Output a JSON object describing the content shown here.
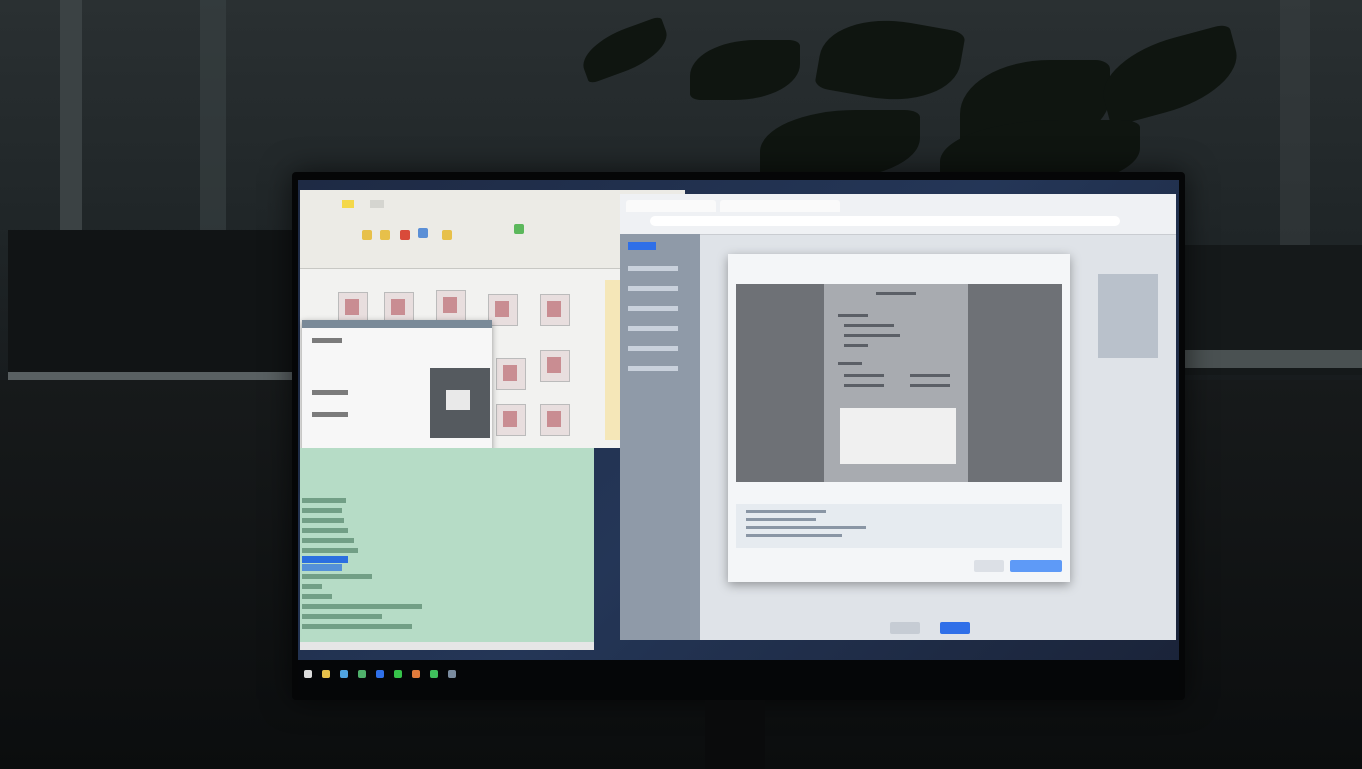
{
  "scene": {
    "description_visible_text": "",
    "browser": {
      "tab_title": "",
      "url": ""
    },
    "modal": {
      "confirm_label": "",
      "cancel_label": ""
    },
    "taskbar": {
      "time": "",
      "date": ""
    }
  }
}
